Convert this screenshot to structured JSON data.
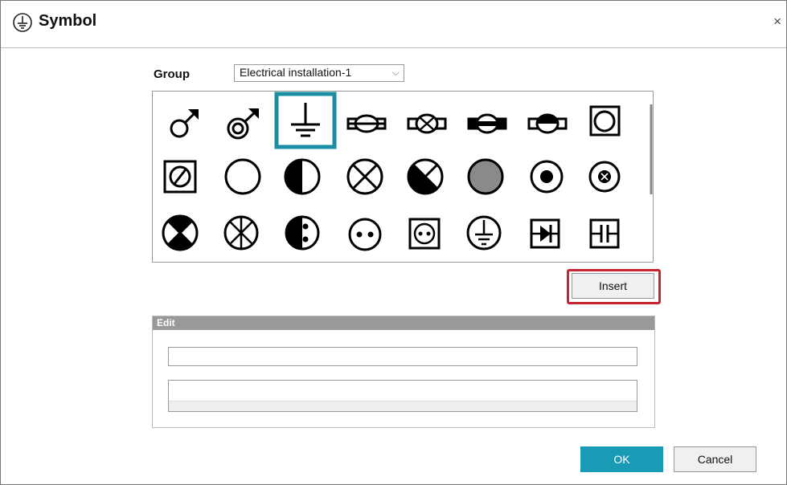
{
  "window": {
    "title": "Symbol",
    "title_icon": "earth-ground-circle-icon",
    "close_label": "×"
  },
  "group": {
    "label": "Group",
    "selected": "Electrical installation-1"
  },
  "symbols": {
    "selected_index": 2,
    "selected_color": "#1a8fa3",
    "items": [
      "male-symbol-icon",
      "double-circle-arrow-icon",
      "earth-ground-icon",
      "lamp-bar-icon",
      "lamp-x-bar-icon",
      "lamp-filled-bar-icon",
      "lamp-half-bar-icon",
      "square-circle-icon",
      "square-slash-circle-icon",
      "circle-icon",
      "half-filled-circle-icon",
      "circle-x-icon",
      "filled-quadrant-x-icon",
      "shaded-circle-icon",
      "circle-dot-icon",
      "circle-small-x-icon",
      "circle-quadrants-filled-icon",
      "circle-star-icon",
      "circle-vertical-dots-icon",
      "circle-horizontal-dots-icon",
      "square-circle-dots-icon",
      "circle-ground-icon",
      "diode-box-icon",
      "capacitor-box-icon"
    ]
  },
  "buttons": {
    "insert": "Insert",
    "ok": "OK",
    "cancel": "Cancel"
  },
  "edit": {
    "header": "Edit",
    "line_value": "",
    "area_value": ""
  },
  "colors": {
    "accent": "#1a9bb5",
    "highlight": "#c62630"
  }
}
